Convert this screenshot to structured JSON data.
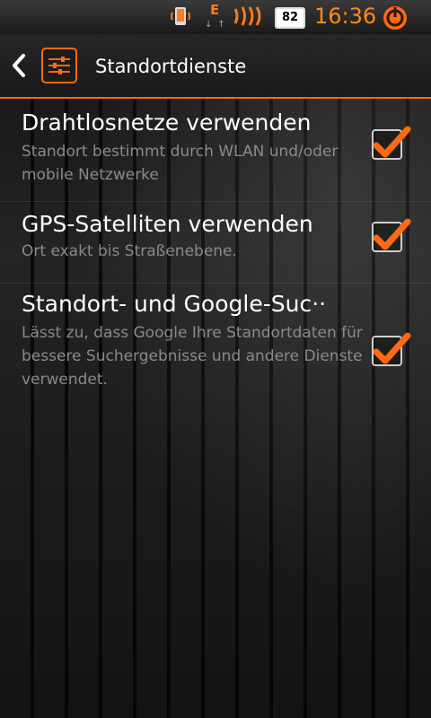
{
  "status_bar": {
    "network_type": "E",
    "battery_level": "82",
    "time": "16:36"
  },
  "header": {
    "title": "Standortdienste"
  },
  "preferences": [
    {
      "title": "Drahtlosnetze verwenden",
      "summary": "Standort bestimmt durch WLAN und/oder mobile Netzwerke",
      "checked": true
    },
    {
      "title": "GPS-Satelliten verwenden",
      "summary": "Ort exakt bis Straßenebene.",
      "checked": true
    },
    {
      "title": "Standort- und Google-Suc··",
      "summary": "Lässt zu, dass Google Ihre Standortdaten für bessere Suchergebnisse und andere Dienste verwendet.",
      "checked": true
    }
  ],
  "colors": {
    "accent": "#ff6a10",
    "summary_text": "#8a8a8a"
  },
  "icons": [
    "phone-icon",
    "signal-icon",
    "battery-icon",
    "power-icon",
    "back-icon",
    "settings-sliders-icon",
    "checkmark-icon"
  ]
}
